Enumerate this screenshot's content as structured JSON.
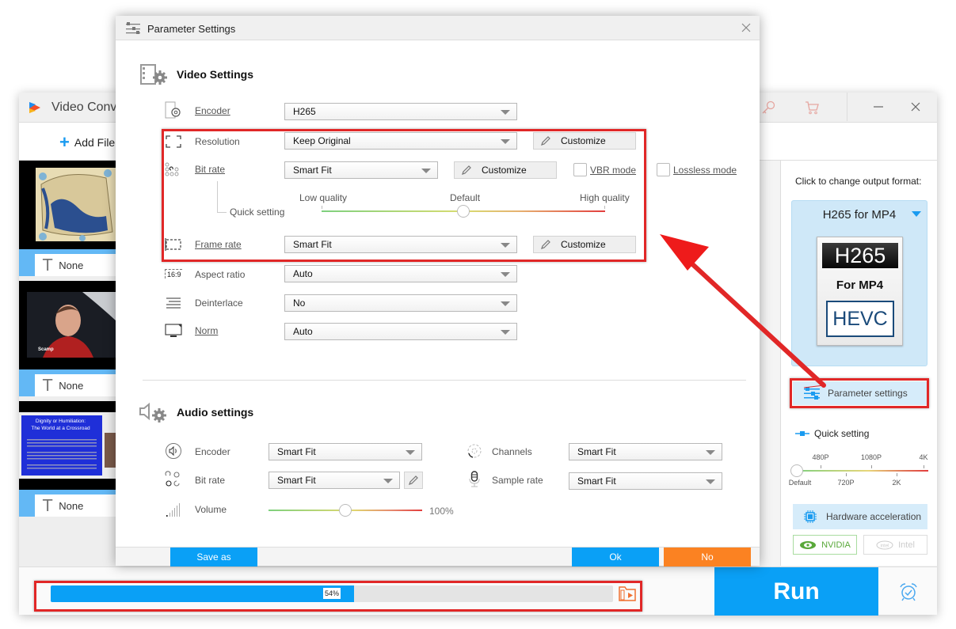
{
  "main_window": {
    "title": "Video Conv",
    "toolbar": {
      "add_file_label": "Add File"
    },
    "files": [
      {
        "subtitle": "None",
        "thumb": "map"
      },
      {
        "subtitle": "None",
        "thumb": "webcam",
        "caption": "Scamp"
      },
      {
        "subtitle": "None",
        "thumb": "slide",
        "slide_title": "Dignity or Humiliation:",
        "slide_subtitle": "The World at a Crossroad"
      }
    ],
    "right_panel": {
      "hint": "Click to change output format:",
      "format_name": "H265 for MP4",
      "badge_top": "H265",
      "badge_mid": "For MP4",
      "badge_bottom": "HEVC",
      "parameter_settings_label": "Parameter settings",
      "quick_setting_label": "Quick setting",
      "quick_setting_ticks_top": [
        "480P",
        "1080P",
        "4K"
      ],
      "quick_setting_ticks_bottom": [
        "Default",
        "720P",
        "2K"
      ],
      "quick_setting_value": "Default",
      "hardware_acceleration_label": "Hardware acceleration",
      "gpu_options": [
        "NVIDIA",
        "Intel"
      ]
    },
    "bottom": {
      "progress_percent": 54,
      "progress_label": "54%",
      "run_label": "Run"
    }
  },
  "dialog": {
    "title": "Parameter Settings",
    "video": {
      "heading": "Video Settings",
      "encoder": {
        "label": "Encoder",
        "value": "H265"
      },
      "resolution": {
        "label": "Resolution",
        "value": "Keep Original",
        "button": "Customize"
      },
      "bitrate": {
        "label": "Bit rate",
        "value": "Smart Fit",
        "button": "Customize",
        "vbr_label": "VBR mode",
        "vbr_checked": false,
        "lossless_label": "Lossless mode",
        "lossless_checked": false
      },
      "quick_setting": {
        "label": "Quick setting",
        "low_label": "Low quality",
        "mid_label": "Default",
        "high_label": "High quality",
        "value": 0.5
      },
      "frame_rate": {
        "label": "Frame rate",
        "value": "Smart Fit",
        "button": "Customize"
      },
      "aspect_ratio": {
        "label": "Aspect ratio",
        "value": "Auto",
        "icon_text": "16:9"
      },
      "deinterlace": {
        "label": "Deinterlace",
        "value": "No"
      },
      "norm": {
        "label": "Norm",
        "value": "Auto"
      }
    },
    "audio": {
      "heading": "Audio settings",
      "encoder": {
        "label": "Encoder",
        "value": "Smart Fit"
      },
      "bitrate": {
        "label": "Bit rate",
        "value": "Smart Fit"
      },
      "channels": {
        "label": "Channels",
        "value": "Smart Fit"
      },
      "sample_rate": {
        "label": "Sample rate",
        "value": "Smart Fit"
      },
      "volume": {
        "label": "Volume",
        "value_label": "100%",
        "value": 0.5
      }
    },
    "footer": {
      "save_as": "Save as",
      "ok": "Ok",
      "no": "No"
    }
  },
  "colors": {
    "accent": "#0aa0f6",
    "cancel": "#fb8222",
    "highlight": "#e12727"
  }
}
